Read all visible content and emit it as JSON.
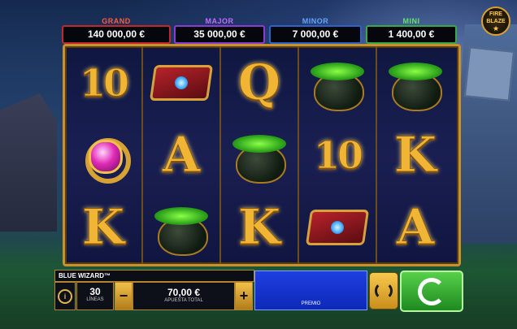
{
  "game": {
    "title": "BLUE WIZARD™",
    "logo_text": "FIRE BLAZE"
  },
  "jackpots": [
    {
      "label": "GRAND",
      "value": "140 000,00 €"
    },
    {
      "label": "MAJOR",
      "value": "35 000,00 €"
    },
    {
      "label": "MINOR",
      "value": "7 000,00 €"
    },
    {
      "label": "MINI",
      "value": "1 400,00 €"
    }
  ],
  "reels": [
    [
      "10",
      "ring",
      "K"
    ],
    [
      "book",
      "A",
      "cauldron"
    ],
    [
      "Q",
      "cauldron",
      "K"
    ],
    [
      "cauldron",
      "10",
      "book"
    ],
    [
      "cauldron",
      "K",
      "A"
    ]
  ],
  "controls": {
    "lines_value": "30",
    "lines_label": "LÍNEAS",
    "bet_value": "70,00 €",
    "bet_label": "APUESTA TOTAL",
    "minus": "−",
    "plus": "+",
    "premio_label": "PREMIO",
    "info_icon": "info-icon",
    "autoplay_icon": "autoplay-icon",
    "spin_icon": "spin-icon"
  }
}
